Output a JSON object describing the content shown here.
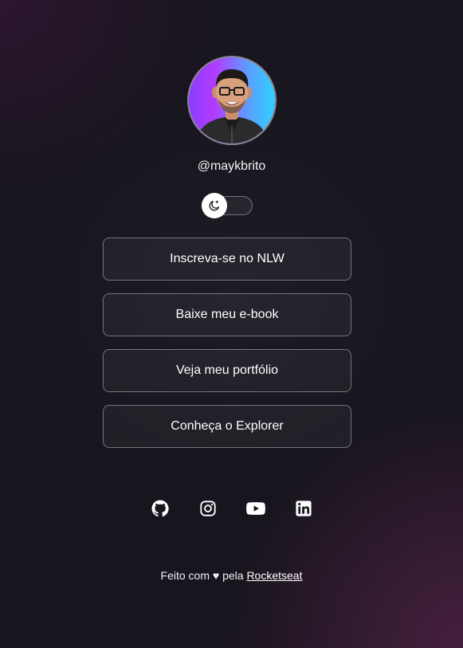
{
  "profile": {
    "handle": "@maykbrito"
  },
  "links": [
    {
      "label": "Inscreva-se no NLW"
    },
    {
      "label": "Baixe meu e-book"
    },
    {
      "label": "Veja meu portfólio"
    },
    {
      "label": "Conheça o Explorer"
    }
  ],
  "social": [
    {
      "icon": "github-icon"
    },
    {
      "icon": "instagram-icon"
    },
    {
      "icon": "youtube-icon"
    },
    {
      "icon": "linkedin-icon"
    }
  ],
  "footer": {
    "prefix": "Feito com ♥ pela ",
    "link_label": "Rocketseat"
  },
  "theme": {
    "background": "#17151d",
    "accent_gradient": [
      "#8b3dff",
      "#2ed0ff"
    ]
  }
}
